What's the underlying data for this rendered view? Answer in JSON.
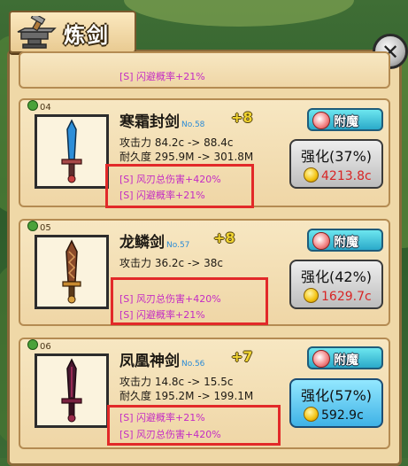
{
  "title": "炼剑",
  "top_card": {
    "bonus": "[S] 闪避概率+21%"
  },
  "swords": [
    {
      "index": "04",
      "name": "寒霜封剑",
      "no": "No.58",
      "level": "+8",
      "attack": "攻击力 84.2c -> 88.4c",
      "durability": "耐久度 295.9M -> 301.8M",
      "bonuses": [
        "[S] 风刃总伤害+420%",
        "[S] 闪避概率+21%"
      ],
      "enchant": "附魔",
      "upgrade": "强化(37%)",
      "cost": "4213.8c"
    },
    {
      "index": "05",
      "name": "龙鳞剑",
      "no": "No.57",
      "level": "+8",
      "attack": "攻击力 36.2c -> 38c",
      "durability": "",
      "bonuses": [
        "[S] 风刃总伤害+420%",
        "[S] 闪避概率+21%"
      ],
      "enchant": "附魔",
      "upgrade": "强化(42%)",
      "cost": "1629.7c"
    },
    {
      "index": "06",
      "name": "凤凰神剑",
      "no": "No.56",
      "level": "+7",
      "attack": "攻击力 14.8c -> 15.5c",
      "durability": "耐久度 195.2M -> 199.1M",
      "bonuses": [
        "[S] 闪避概率+21%",
        "[S] 风刃总伤害+420%"
      ],
      "enchant": "附魔",
      "upgrade": "强化(57%)",
      "cost": "592.9c"
    }
  ],
  "close_label": "✕"
}
